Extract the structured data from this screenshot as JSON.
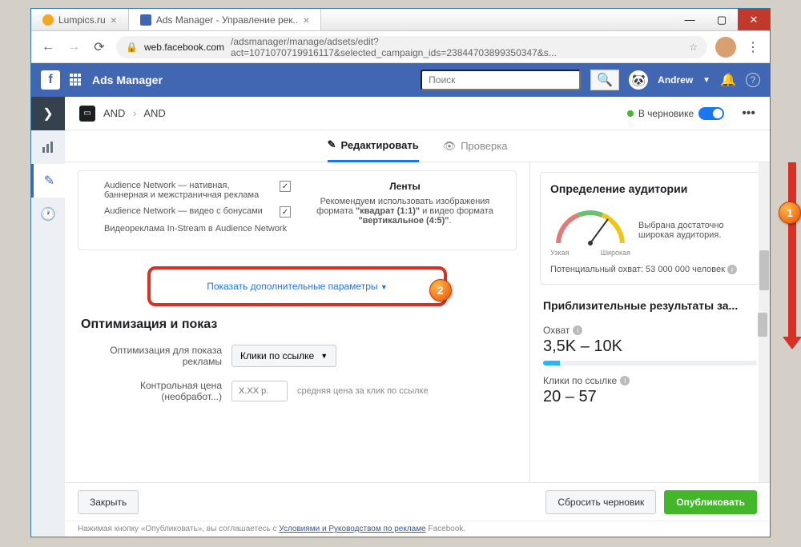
{
  "browser": {
    "tabs": [
      {
        "title": "Lumpics.ru",
        "favicon_color": "#f5a623"
      },
      {
        "title": "Ads Manager - Управление рек..",
        "favicon_color": "#4267b2"
      }
    ],
    "url_host": "web.facebook.com",
    "url_path": "/adsmanager/manage/adsets/edit?act=1071070719916117&selected_campaign_ids=23844703899350347&s..."
  },
  "fb_header": {
    "title": "Ads Manager",
    "search_placeholder": "Поиск",
    "user": "Andrew"
  },
  "breadcrumb": {
    "a": "AND",
    "b": "AND"
  },
  "draft_label": "В черновике",
  "page_tabs": {
    "edit": "Редактировать",
    "review": "Проверка"
  },
  "placements": {
    "opt1": "Audience Network — нативная, баннерная и межстраничная реклама",
    "opt2": "Audience Network — видео с бонусами",
    "opt3": "Видеореклама In-Stream в Audience Network",
    "right_h": "Ленты",
    "right_text_pre": "Рекомендуем использовать изображения формата ",
    "right_b1": "\"квадрат (1:1)\"",
    "right_mid": " и видео формата ",
    "right_b2": "\"вертикальное (4:5)\"",
    "right_end": "."
  },
  "show_more": "Показать дополнительные параметры",
  "optim": {
    "heading": "Оптимизация и показ",
    "row1_label": "Оптимизация для показа рекламы",
    "row1_value": "Клики по ссылке",
    "row2_label": "Контрольная цена (необработ...)",
    "row2_placeholder": "X.XX р.",
    "row2_hint": "средняя цена за клик по ссылке"
  },
  "audience": {
    "heading": "Определение аудитории",
    "narrow": "Узкая",
    "broad": "Широкая",
    "desc": "Выбрана достаточно широкая аудитория.",
    "reach_label": "Потенциальный охват:",
    "reach_value": "53 000 000 человек"
  },
  "results": {
    "heading": "Приблизительные результаты за...",
    "m1_label": "Охват",
    "m1_value": "3,5K – 10K",
    "m2_label": "Клики по ссылке",
    "m2_value": "20 – 57"
  },
  "footer": {
    "close": "Закрыть",
    "reset": "Сбросить черновик",
    "publish": "Опубликовать",
    "note_pre": "Нажимая кнопку «Опубликовать», вы соглашаетесь с ",
    "note_link": "Условиями и Руководством по рекламе",
    "note_post": " Facebook."
  },
  "badges": {
    "one": "1",
    "two": "2"
  }
}
